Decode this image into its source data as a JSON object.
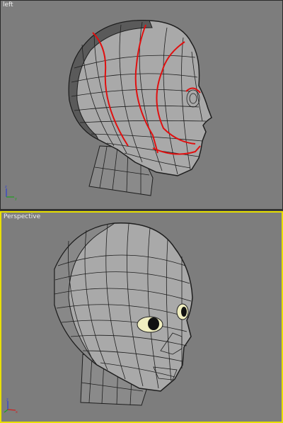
{
  "viewports": [
    {
      "label": "left",
      "active": false
    },
    {
      "label": "Perspective",
      "active": true
    }
  ],
  "axis_gizmo": {
    "left_view": [
      "z",
      "y"
    ],
    "perspective_view": [
      "z",
      "x"
    ]
  },
  "colors": {
    "background": "#7d7d7d",
    "active_border": "#e8e000",
    "mesh": "#a9a9a9",
    "wire": "#1e1e1e",
    "edge_loops": "#e01010"
  }
}
